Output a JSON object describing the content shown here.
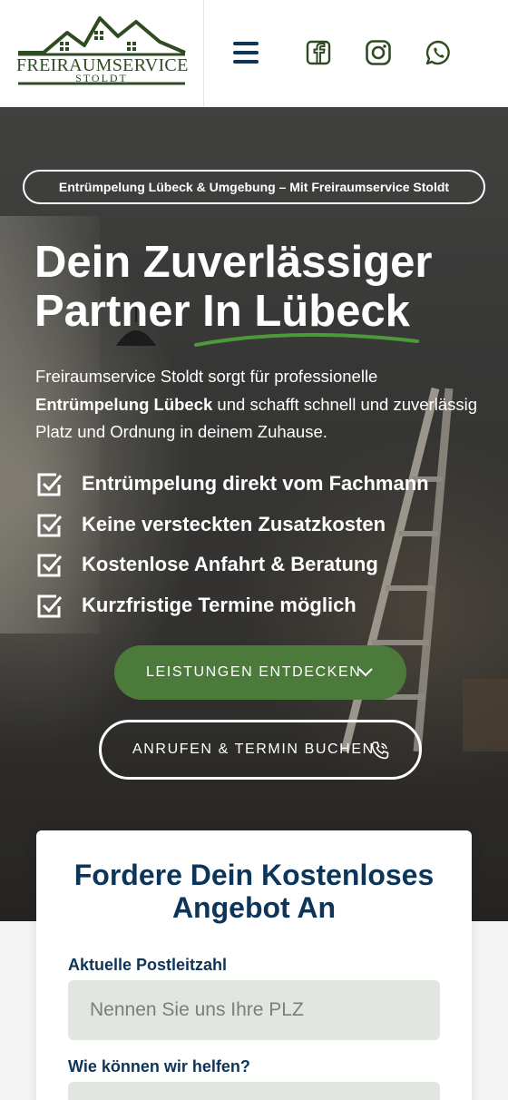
{
  "header": {
    "logo": {
      "name": "FREIRAUMSERVICE",
      "sub": "STOLDT",
      "brand_color": "#2f4b22"
    },
    "menu_icon": "hamburger-icon",
    "social": [
      {
        "name": "facebook",
        "icon": "facebook-icon"
      },
      {
        "name": "instagram",
        "icon": "instagram-icon"
      },
      {
        "name": "whatsapp",
        "icon": "whatsapp-icon"
      }
    ],
    "nav_color": "#0d3559"
  },
  "hero": {
    "badge": "Entrümpelung Lübeck & Umgebung – Mit Freiraumservice Stoldt",
    "headline_line1": "Dein Zuverlässiger",
    "headline_line2": "Partner In Lübeck",
    "intro_part1": "Freiraumservice Stoldt sorgt für professionelle ",
    "intro_bold": "Entrümpelung Lübeck",
    "intro_part2": " und schafft schnell und zuverlässig Platz und Ordnung in deinem Zuhause.",
    "checklist": [
      "Entrümpelung direkt vom Fachmann",
      "Keine versteckten Zusatzkosten",
      "Kostenlose Anfahrt & Beratung",
      "Kurzfristige Termine möglich"
    ],
    "primary_button": "LEISTUNGEN ENTDECKEN",
    "secondary_button": "ANRUFEN & TERMIN BUCHEN",
    "accent_color": "#4c7a3b"
  },
  "form": {
    "title": "Fordere Dein Kostenloses Angebot An",
    "postcode_label": "Aktuelle Postleitzahl",
    "postcode_placeholder": "Nennen Sie uns Ihre PLZ",
    "help_label": "Wie können wir helfen?"
  }
}
